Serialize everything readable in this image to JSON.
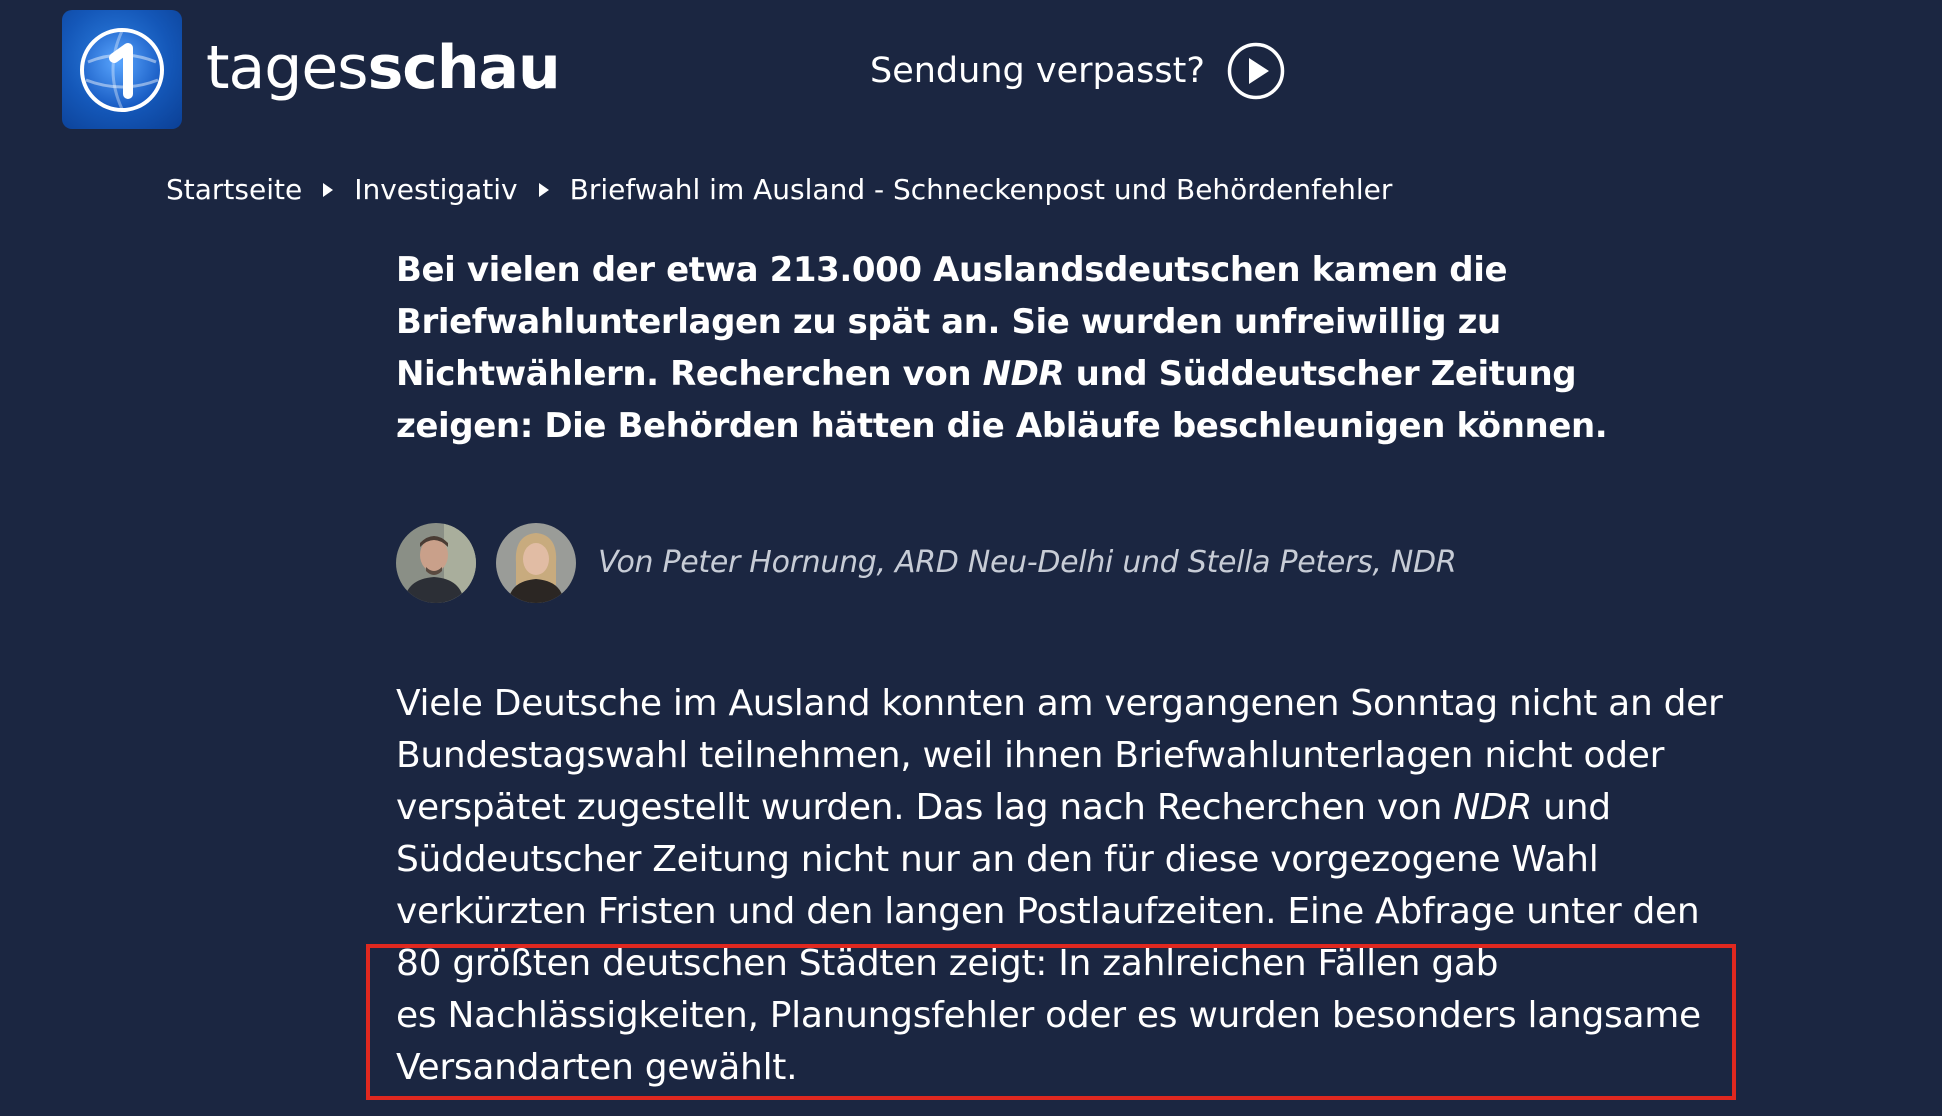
{
  "header": {
    "logo_icon": "ard-one-logo-icon",
    "brand_light": "tages",
    "brand_bold": "schau",
    "missed_label": "Sendung verpasst?",
    "play_icon": "play-circle-icon"
  },
  "breadcrumb": {
    "items": [
      "Startseite",
      "Investigativ"
    ],
    "current": "Briefwahl im Ausland - Schneckenpost und Behördenfehler",
    "separator_icon": "triangle-right-icon"
  },
  "lead": {
    "text_part1": "Bei vielen der etwa 213.000 Auslandsdeutschen kamen die Briefwahlunterlagen zu spät an. Sie wurden unfreiwillig zu Nichtwählern. Recherchen von ",
    "text_italic": "NDR",
    "text_part2": " und Süddeutscher Zeitung zeigen: Die Behörden hätten die Abläufe beschleunigen können."
  },
  "authors": {
    "avatars": [
      "author-avatar-peter-hornung",
      "author-avatar-stella-peters"
    ],
    "byline": "Von Peter Hornung, ARD Neu-Delhi und Stella Peters, NDR"
  },
  "body": {
    "line1": "Viele Deutsche im Ausland konnten am vergangenen Sonntag nicht an der",
    "line2": "Bundestagswahl teilnehmen, weil ihnen Briefwahlunterlagen nicht oder",
    "line3_before": "verspätet zugestellt wurden. Das lag nach Recherchen von ",
    "line3_italic": "NDR",
    "line3_after": " und",
    "line4": "Süddeutscher Zeitung nicht nur an den für diese vorgezogene Wahl",
    "line5": "verkürzten Fristen und den langen Postlaufzeiten. Eine Abfrage unter den",
    "line6": "80 größten deutschen Städten zeigt: In zahlreichen Fällen gab",
    "line7": "es Nachlässigkeiten, Planungsfehler oder es wurden besonders langsame",
    "line8": "Versandarten gewählt."
  },
  "colors": {
    "background": "#1b2641",
    "text": "#ffffff",
    "byline": "#c7ccd6",
    "logo_blue": "#1457b8",
    "highlight_border": "#e0281f"
  }
}
